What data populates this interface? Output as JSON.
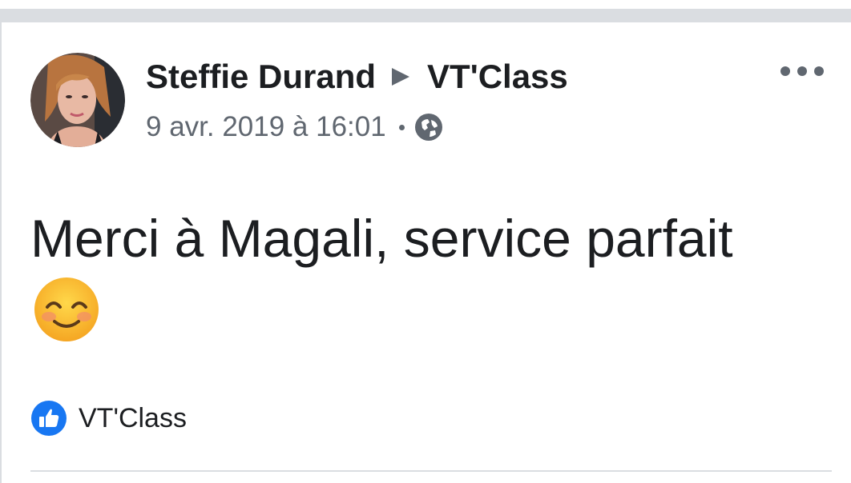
{
  "post": {
    "author_name": "Steffie Durand",
    "target_page": "VT'Class",
    "timestamp": "9 avr. 2019 à 16:01",
    "privacy_icon": "globe-icon",
    "text": "Merci à Magali, service parfait",
    "emoji_icon": "smiling-face-icon",
    "tagged_page": "VT'Class",
    "tag_icon": "like-icon",
    "menu_icon": "more-options-icon"
  },
  "colors": {
    "primary_text": "#1c1e21",
    "secondary_text": "#606770",
    "divider": "#dadde1",
    "facebook_blue": "#1877f2"
  }
}
